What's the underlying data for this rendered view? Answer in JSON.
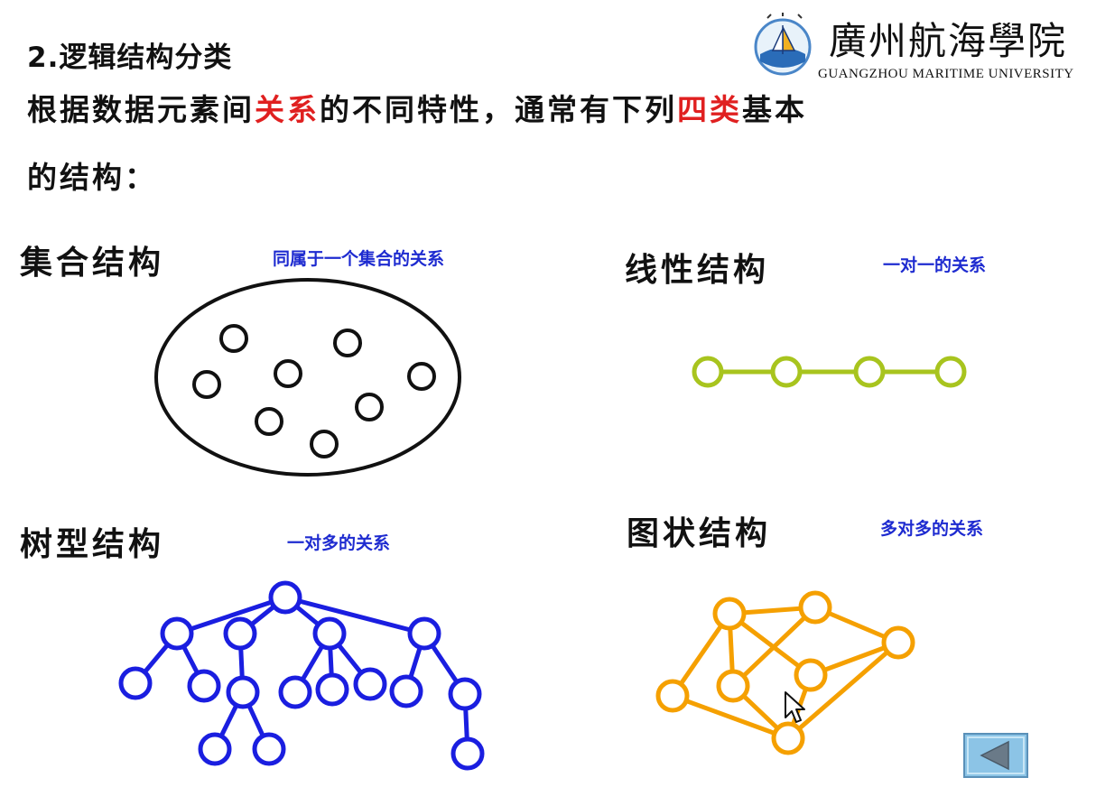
{
  "header": {
    "heading": "2.逻辑结构分类",
    "intro_line1_a": "根据数据元素间",
    "intro_line1_red1": "关系",
    "intro_line1_b": "的不同特性，通常有下列",
    "intro_line1_red2": "四类",
    "intro_line1_c": "基本",
    "intro_line2": "的结构："
  },
  "logo": {
    "name_cn": "廣州航海學院",
    "name_en": "GUANGZHOU MARITIME UNIVERSITY",
    "icon": "university-emblem-icon"
  },
  "sections": {
    "set": {
      "title": "集合结构",
      "desc": "同属于一个集合的关系",
      "color": "#111111"
    },
    "linear": {
      "title": "线性结构",
      "desc": "一对一的关系",
      "color": "#a8c41e"
    },
    "tree": {
      "title": "树型结构",
      "desc": "一对多的关系",
      "color": "#1a1ee0"
    },
    "graph": {
      "title": "图状结构",
      "desc": "多对多的关系",
      "color": "#f5a000"
    }
  },
  "colors": {
    "accent_red": "#e02020",
    "desc_blue": "#1e2bd0",
    "button_bg": "#8cc4e6"
  },
  "controls": {
    "back_icon": "back-triangle-icon",
    "cursor_icon": "mouse-cursor-icon"
  }
}
